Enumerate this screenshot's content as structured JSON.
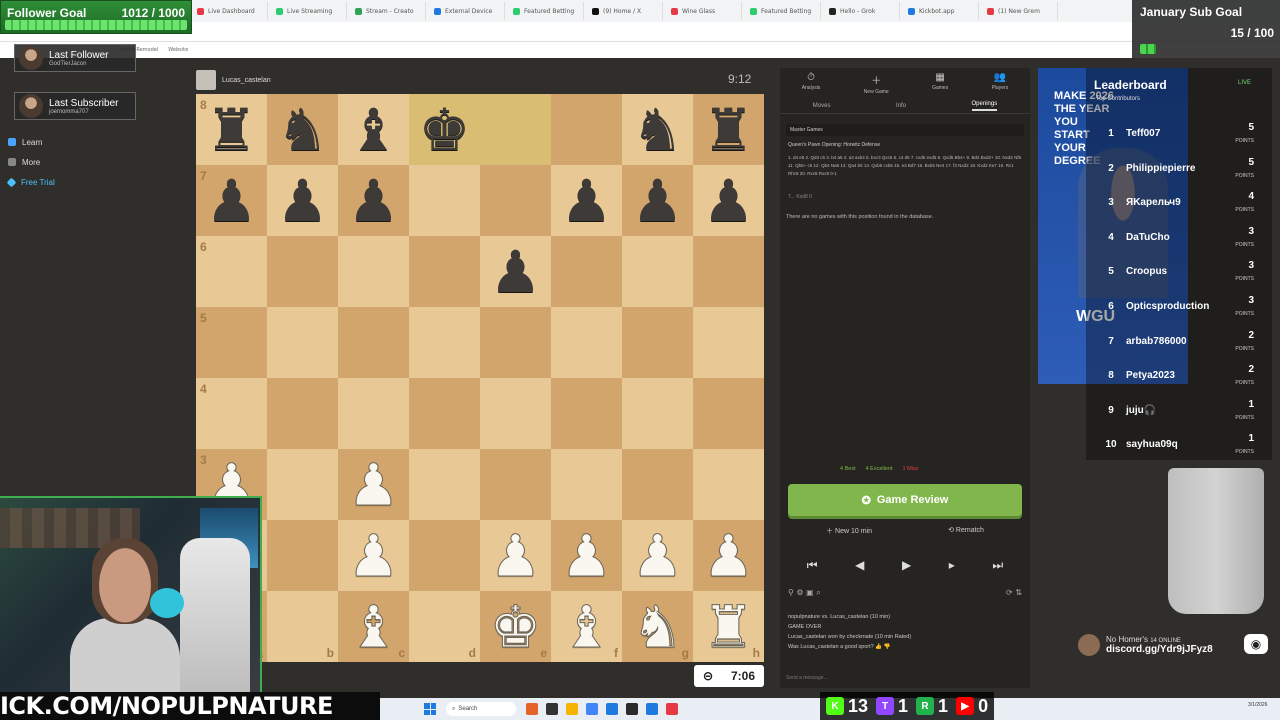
{
  "browser": {
    "tabs": [
      "Play Chess Onl",
      "Live Dashboard",
      "Live Streaming",
      "Stream - Creato",
      "External Device",
      "Featured Betting",
      "(9) Home / X",
      "Wine Glass",
      "Featured Betting",
      "Hello - Grok",
      "Kickbot.app",
      "(1) New Grem"
    ],
    "tab_colors": [
      "#81b64c",
      "#e63946",
      "#2dcc70",
      "#2fa35a",
      "#1f7ae0",
      "#2dcc70",
      "#111111",
      "#e63946",
      "#2dcc70",
      "#222222",
      "#1f7ae0",
      "#e63946"
    ],
    "bookmarks": [
      "Home Remodel",
      "Website"
    ]
  },
  "left_nav": [
    {
      "label": "Learn",
      "color": "#4aa3ff"
    },
    {
      "label": "More",
      "color": "#888888"
    },
    {
      "label": "Free Trial",
      "color": "#4ac0ff"
    }
  ],
  "follower_goal": {
    "title": "Follower Goal",
    "count": "1012 / 1000"
  },
  "sub_goal": {
    "title": "January Sub Goal",
    "count": "15 / 100"
  },
  "alerts": [
    {
      "label": "Last Follower",
      "name": "GodTierJacon"
    },
    {
      "label": "Last Subscriber",
      "name": "joemomma707"
    }
  ],
  "player_top": {
    "name": "Lucas_castelan",
    "clock": "9:12"
  },
  "clock_bottom": "7:06",
  "board": {
    "ranks": [
      "8",
      "7",
      "6",
      "5",
      "4",
      "3",
      "2",
      "1"
    ],
    "files": [
      "a",
      "b",
      "c",
      "d",
      "e",
      "f",
      "g",
      "h"
    ],
    "rows": [
      [
        "r",
        "n",
        "b",
        "k",
        "",
        "",
        "n",
        "r"
      ],
      [
        "p",
        "p",
        "p",
        "",
        "",
        "p",
        "p",
        "p"
      ],
      [
        "",
        "",
        "",
        "",
        "p",
        "",
        "",
        ""
      ],
      [
        "",
        "",
        "",
        "",
        "",
        "",
        "",
        ""
      ],
      [
        "",
        "",
        "",
        "",
        "",
        "",
        "",
        ""
      ],
      [
        "P",
        "",
        "P",
        "",
        "",
        "",
        "",
        ""
      ],
      [
        "",
        "",
        "P",
        "",
        "P",
        "P",
        "P",
        "P"
      ],
      [
        "",
        "",
        "B",
        "",
        "K",
        "B",
        "N",
        "R"
      ]
    ],
    "highlight": [
      [
        0,
        4
      ],
      [
        0,
        3
      ]
    ]
  },
  "panel": {
    "tabs": [
      {
        "label": "Analysis",
        "icon": "⏱"
      },
      {
        "label": "New Game",
        "icon": "＋"
      },
      {
        "label": "Games",
        "icon": "▦"
      },
      {
        "label": "Players",
        "icon": "👥"
      }
    ],
    "subtabs": [
      "Moves",
      "Info",
      "Openings"
    ],
    "db_label": "Master Games",
    "opening": "Queen's Pawn Opening: Horwitz Defense",
    "moves": "1. d4 e6 2. Qd3 c5 3. b4 a5 4. a3 axb4 5. bxc3 Qxc5 6. c4 d5 7. cxd5 exd5 8. Qxd5 Bb4+ 9. Bd2 Bxd2+ 10. Nxd2 Nf6 11. Qb5+ c6 12. Qb4 Na6 13. Qa4 b5 14. Qxb5 cxb5 15. e3 Bd7 16. Bxb5 Ne4 17. f3 Nxd2 18. Kxd2 Ke7 19. Rc1 Rhc8 20. Rxc8 Rxc8 0-1",
    "move_score": "7... Kxd8     0",
    "no_games": "There are no games with this position found in the database.",
    "evals": [
      {
        "label": "4 Best",
        "color": "#81b64c"
      },
      {
        "label": "4 Excellent",
        "color": "#81b64c"
      },
      {
        "label": "1 Miss",
        "color": "#e63946"
      }
    ],
    "review_label": "Game Review",
    "new_game_label": "New 10 min",
    "rematch_label": "Rematch",
    "chat": [
      "nopulpnature vs. Lucas_castelan (10 min)",
      "GAME OVER",
      "Lucas_castelan won by checkmate (10 min Rated)",
      "Was Lucas_castelan a good sport?"
    ],
    "chat_placeholder": "Send a message..."
  },
  "ad": {
    "headline": "MAKE 2026 THE YEAR YOU START YOUR DEGREE",
    "logo": "WGU"
  },
  "leaderboard": {
    "title": "Leaderboard",
    "subtitle": "Top Contributors",
    "points_label": "POINTS",
    "entries": [
      {
        "rank": "1",
        "name": "Teff007",
        "points": "5"
      },
      {
        "rank": "2",
        "name": "Philippiepierre",
        "points": "5"
      },
      {
        "rank": "3",
        "name": "ЯKарельч9",
        "points": "4"
      },
      {
        "rank": "4",
        "name": "DaTuCho",
        "points": "3"
      },
      {
        "rank": "5",
        "name": "Croopus",
        "points": "3"
      },
      {
        "rank": "6",
        "name": "Opticsproduction",
        "points": "3"
      },
      {
        "rank": "7",
        "name": "arbab786000",
        "points": "2"
      },
      {
        "rank": "8",
        "name": "Petya2023",
        "points": "2"
      },
      {
        "rank": "9",
        "name": "juju🎧",
        "points": "1"
      },
      {
        "rank": "10",
        "name": "sayhua09q",
        "points": "1"
      }
    ]
  },
  "live_label": "LIVE",
  "discord": {
    "line1": "No Homer's",
    "online": "14 ONLINE",
    "invite": "discord.gg/Ydr9jJFyz8"
  },
  "kick_banner": "ICK.COM/NOPULPNATURE",
  "taskbar": {
    "search": "Search",
    "date": "3/1/2026"
  },
  "viewer_stats": [
    {
      "count": "13",
      "color": "#53fc18",
      "glyph": "K"
    },
    {
      "count": "1",
      "color": "#9146ff",
      "glyph": "T"
    },
    {
      "count": "1",
      "color": "#21b24b",
      "glyph": "R"
    },
    {
      "count": "0",
      "color": "#ff0000",
      "glyph": "▶"
    }
  ]
}
